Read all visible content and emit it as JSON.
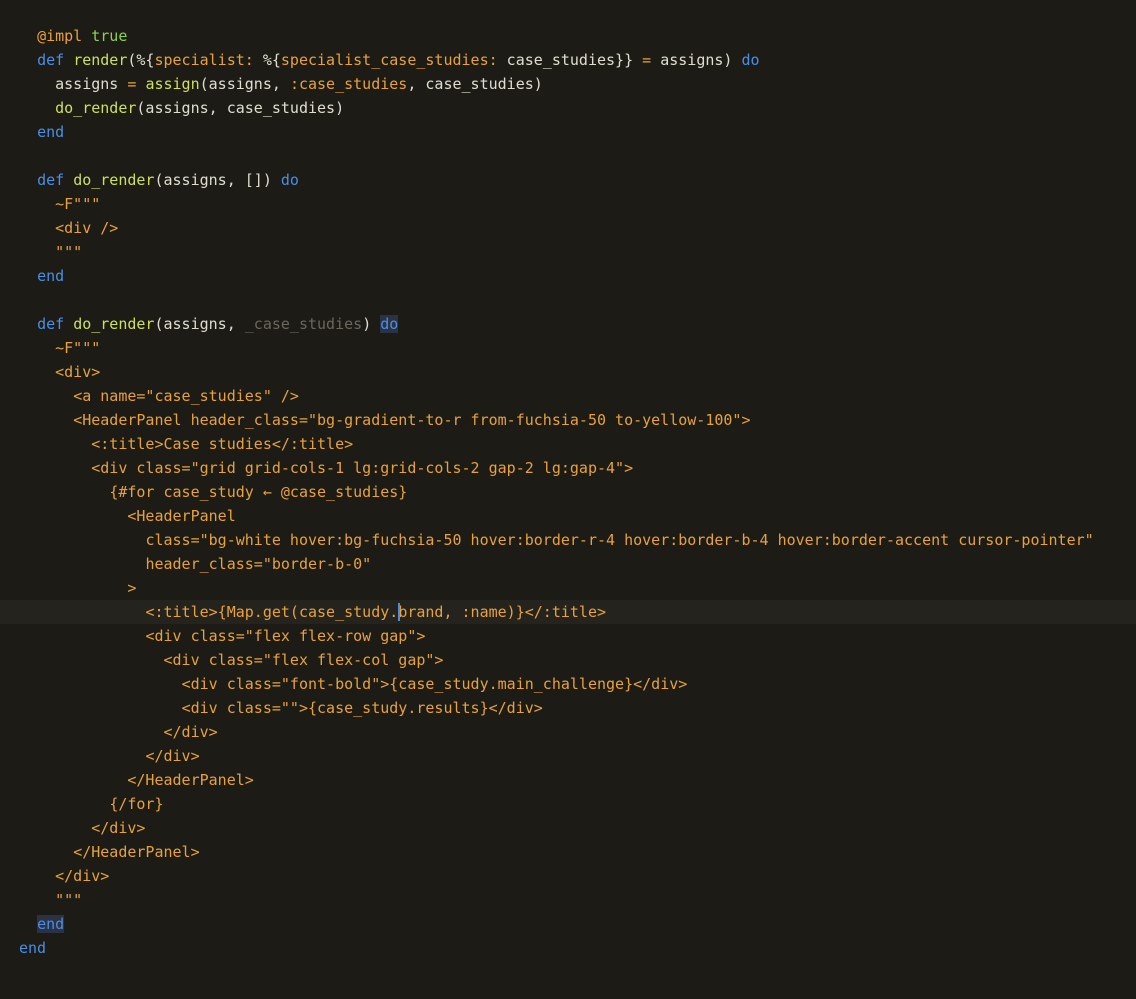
{
  "colors": {
    "background": "#1c1b16",
    "current_line": "#24231d",
    "cursor": "#4a8ee6",
    "match_highlight": "#2a3244",
    "plain": "#e0ddd0",
    "keyword": "#4a8ee6",
    "function": "#cfe05a",
    "string": "#e8a23c",
    "module_attr": "#e8a23c",
    "boolean": "#8fd14f",
    "comment": "#6a675c"
  },
  "editor": {
    "current_line_index": 24,
    "lines": [
      [
        {
          "t": "  "
        },
        {
          "t": "@impl",
          "c": "module_attr"
        },
        {
          "t": " "
        },
        {
          "t": "true",
          "c": "boolean"
        }
      ],
      [
        {
          "t": "  "
        },
        {
          "t": "def",
          "c": "keyword"
        },
        {
          "t": " "
        },
        {
          "t": "render",
          "c": "function"
        },
        {
          "t": "(%{"
        },
        {
          "t": "specialist:",
          "c": "string"
        },
        {
          "t": " %{"
        },
        {
          "t": "specialist_case_studies:",
          "c": "string"
        },
        {
          "t": " case_studies}} "
        },
        {
          "t": "=",
          "c": "string"
        },
        {
          "t": " assigns) "
        },
        {
          "t": "do",
          "c": "keyword"
        }
      ],
      [
        {
          "t": "    assigns "
        },
        {
          "t": "=",
          "c": "string"
        },
        {
          "t": " "
        },
        {
          "t": "assign",
          "c": "function"
        },
        {
          "t": "(assigns, "
        },
        {
          "t": ":case_studies",
          "c": "string"
        },
        {
          "t": ", case_studies)"
        }
      ],
      [
        {
          "t": "    "
        },
        {
          "t": "do_render",
          "c": "function"
        },
        {
          "t": "(assigns, case_studies)"
        }
      ],
      [
        {
          "t": "  "
        },
        {
          "t": "end",
          "c": "keyword"
        }
      ],
      [
        {
          "t": ""
        }
      ],
      [
        {
          "t": "  "
        },
        {
          "t": "def",
          "c": "keyword"
        },
        {
          "t": " "
        },
        {
          "t": "do_render",
          "c": "function"
        },
        {
          "t": "(assigns, []) "
        },
        {
          "t": "do",
          "c": "keyword"
        }
      ],
      [
        {
          "t": "    "
        },
        {
          "t": "~F\"\"\"",
          "c": "string"
        }
      ],
      [
        {
          "t": "    "
        },
        {
          "t": "<div />",
          "c": "string"
        }
      ],
      [
        {
          "t": "    "
        },
        {
          "t": "\"\"\"",
          "c": "string"
        }
      ],
      [
        {
          "t": "  "
        },
        {
          "t": "end",
          "c": "keyword"
        }
      ],
      [
        {
          "t": ""
        }
      ],
      [
        {
          "t": "  "
        },
        {
          "t": "def",
          "c": "keyword"
        },
        {
          "t": " "
        },
        {
          "t": "do_render",
          "c": "function"
        },
        {
          "t": "(assigns, "
        },
        {
          "t": "_case_studies",
          "c": "comment"
        },
        {
          "t": ") "
        },
        {
          "t": "do",
          "c": "keyword",
          "hl": true
        }
      ],
      [
        {
          "t": "    "
        },
        {
          "t": "~F\"\"\"",
          "c": "string"
        }
      ],
      [
        {
          "t": "    "
        },
        {
          "t": "<div>",
          "c": "string"
        }
      ],
      [
        {
          "t": "      "
        },
        {
          "t": "<a name=\"case_studies\" />",
          "c": "string"
        }
      ],
      [
        {
          "t": "      "
        },
        {
          "t": "<HeaderPanel header_class=\"bg-gradient-to-r from-fuchsia-50 to-yellow-100\">",
          "c": "string"
        }
      ],
      [
        {
          "t": "        "
        },
        {
          "t": "<:title>Case studies</:title>",
          "c": "string"
        }
      ],
      [
        {
          "t": "        "
        },
        {
          "t": "<div class=\"grid grid-cols-1 lg:grid-cols-2 gap-2 lg:gap-4\">",
          "c": "string"
        }
      ],
      [
        {
          "t": "          "
        },
        {
          "t": "{#for case_study ← @case_studies}",
          "c": "string"
        }
      ],
      [
        {
          "t": "            "
        },
        {
          "t": "<HeaderPanel",
          "c": "string"
        }
      ],
      [
        {
          "t": "              "
        },
        {
          "t": "class=\"bg-white hover:bg-fuchsia-50 hover:border-r-4 hover:border-b-4 hover:border-accent cursor-pointer\"",
          "c": "string"
        }
      ],
      [
        {
          "t": "              "
        },
        {
          "t": "header_class=\"border-b-0\"",
          "c": "string"
        }
      ],
      [
        {
          "t": "            "
        },
        {
          "t": ">",
          "c": "string"
        }
      ],
      [
        {
          "t": "              "
        },
        {
          "t": "<:title>{Map.get(case_study.",
          "c": "string"
        },
        {
          "cursor": true
        },
        {
          "t": "brand, :name)}</:title>",
          "c": "string"
        }
      ],
      [
        {
          "t": "              "
        },
        {
          "t": "<div class=\"flex flex-row gap\">",
          "c": "string"
        }
      ],
      [
        {
          "t": "                "
        },
        {
          "t": "<div class=\"flex flex-col gap\">",
          "c": "string"
        }
      ],
      [
        {
          "t": "                  "
        },
        {
          "t": "<div class=\"font-bold\">{case_study.main_challenge}</div>",
          "c": "string"
        }
      ],
      [
        {
          "t": "                  "
        },
        {
          "t": "<div class=\"\">{case_study.results}</div>",
          "c": "string"
        }
      ],
      [
        {
          "t": "                "
        },
        {
          "t": "</div>",
          "c": "string"
        }
      ],
      [
        {
          "t": "              "
        },
        {
          "t": "</div>",
          "c": "string"
        }
      ],
      [
        {
          "t": "            "
        },
        {
          "t": "</HeaderPanel>",
          "c": "string"
        }
      ],
      [
        {
          "t": "          "
        },
        {
          "t": "{/for}",
          "c": "string"
        }
      ],
      [
        {
          "t": "        "
        },
        {
          "t": "</div>",
          "c": "string"
        }
      ],
      [
        {
          "t": "      "
        },
        {
          "t": "</HeaderPanel>",
          "c": "string"
        }
      ],
      [
        {
          "t": "    "
        },
        {
          "t": "</div>",
          "c": "string"
        }
      ],
      [
        {
          "t": "    "
        },
        {
          "t": "\"\"\"",
          "c": "string"
        }
      ],
      [
        {
          "t": "  "
        },
        {
          "t": "end",
          "c": "keyword",
          "hl": true
        }
      ],
      [
        {
          "t": "end",
          "c": "keyword"
        }
      ]
    ]
  }
}
